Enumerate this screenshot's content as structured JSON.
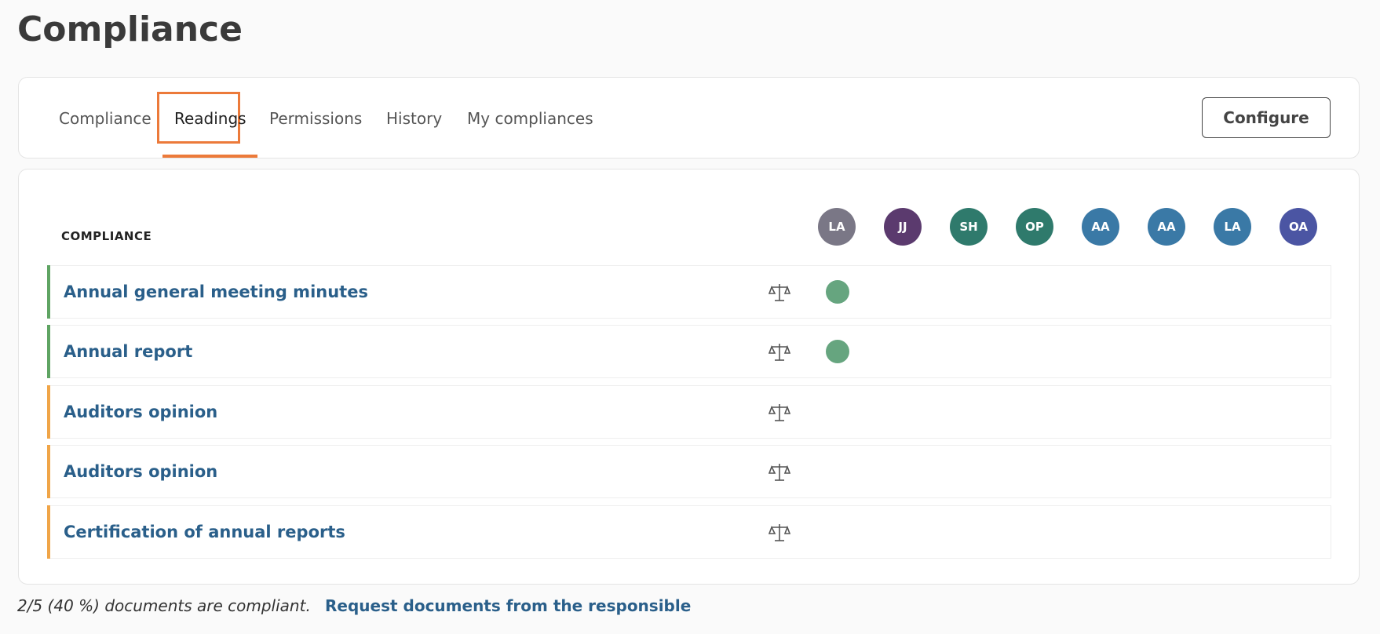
{
  "page": {
    "title": "Compliance"
  },
  "tabs": [
    {
      "label": "Compliance",
      "active": false
    },
    {
      "label": "Readings",
      "active": true
    },
    {
      "label": "Permissions",
      "active": false
    },
    {
      "label": "History",
      "active": false
    },
    {
      "label": "My compliances",
      "active": false
    }
  ],
  "toolbar": {
    "configure_label": "Configure"
  },
  "table": {
    "column_header": "COMPLIANCE",
    "avatars": [
      {
        "initials": "LA",
        "color": "#7a7786"
      },
      {
        "initials": "JJ",
        "color": "#5b3a6e"
      },
      {
        "initials": "SH",
        "color": "#2f7a6c"
      },
      {
        "initials": "OP",
        "color": "#2f7a6c"
      },
      {
        "initials": "AA",
        "color": "#3a79a6"
      },
      {
        "initials": "AA",
        "color": "#3a79a6"
      },
      {
        "initials": "LA",
        "color": "#3a79a6"
      },
      {
        "initials": "OA",
        "color": "#4b55a3"
      }
    ],
    "rows": [
      {
        "title": "Annual general meeting minutes",
        "status": "compliant",
        "bar_color": "#5fa463",
        "icon": "scale-icon"
      },
      {
        "title": "Annual report",
        "status": "compliant",
        "bar_color": "#5fa463",
        "icon": "scale-icon"
      },
      {
        "title": "Auditors opinion",
        "status": "pending",
        "bar_color": "#f0a548",
        "icon": "scale-icon"
      },
      {
        "title": "Auditors opinion",
        "status": "pending",
        "bar_color": "#f0a548",
        "icon": "scale-icon"
      },
      {
        "title": "Certification of annual reports",
        "status": "pending",
        "bar_color": "#f0a548",
        "icon": "scale-icon"
      }
    ]
  },
  "footer": {
    "summary": "2/5 (40 %) documents are compliant.",
    "request_link": "Request documents from the responsible"
  },
  "colors": {
    "accent": "#ec7a3a",
    "link": "#2a5f8a",
    "compliant_dot": "#66a57f"
  }
}
